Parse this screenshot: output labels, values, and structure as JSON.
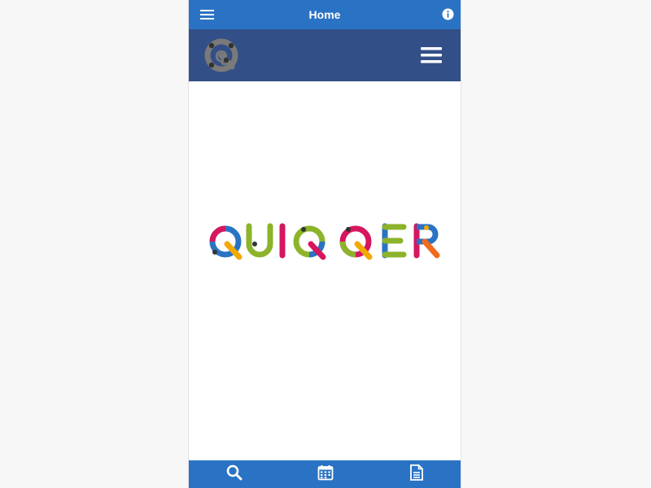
{
  "topbar": {
    "title": "Home",
    "menu_icon": "hamburger-menu-icon",
    "info_icon": "info-icon"
  },
  "header": {
    "logo_icon": "quiqqer-q-logo",
    "nav_icon": "hamburger-menu-icon"
  },
  "main": {
    "wordmark_text": "QUIQQER"
  },
  "bottom_nav": {
    "items": [
      {
        "icon": "search-icon"
      },
      {
        "icon": "calendar-icon"
      },
      {
        "icon": "document-icon"
      }
    ]
  },
  "colors": {
    "topbar": "#2a73c4",
    "header": "#334f87",
    "bottombar": "#2a73c4",
    "background": "#f7f7f7"
  }
}
